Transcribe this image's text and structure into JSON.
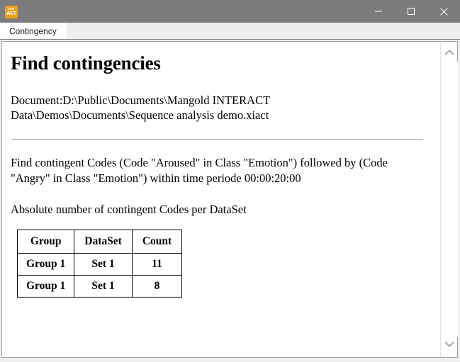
{
  "window": {
    "app_icon_top_text": "inter",
    "app_icon_bottom_text": "ACT",
    "minimize_label": "Minimize",
    "maximize_label": "Maximize",
    "close_label": "Close",
    "titlebar_color": "#7c7c7c"
  },
  "tabs": [
    {
      "label": "Contingency",
      "active": true
    }
  ],
  "document": {
    "title": "Find contingencies",
    "path_line": "Document:D:\\Public\\Documents\\Mangold INTERACT Data\\Demos\\Documents\\Sequence analysis demo.xiact",
    "query_text": "Find contingent Codes (Code \"Aroused\" in Class \"Emotion\") followed by (Code \"Angry\" in Class \"Emotion\") within time periode 00:00:20:00",
    "subcaption": "Absolute number of contingent Codes per DataSet"
  },
  "table": {
    "headers": [
      "Group",
      "DataSet",
      "Count"
    ],
    "rows": [
      [
        "Group 1",
        "Set 1",
        "11"
      ],
      [
        "Group 1",
        "Set 1",
        "8"
      ]
    ]
  },
  "scrollbar": {
    "up_icon": "chevron-up-icon",
    "down_icon": "chevron-down-icon"
  }
}
